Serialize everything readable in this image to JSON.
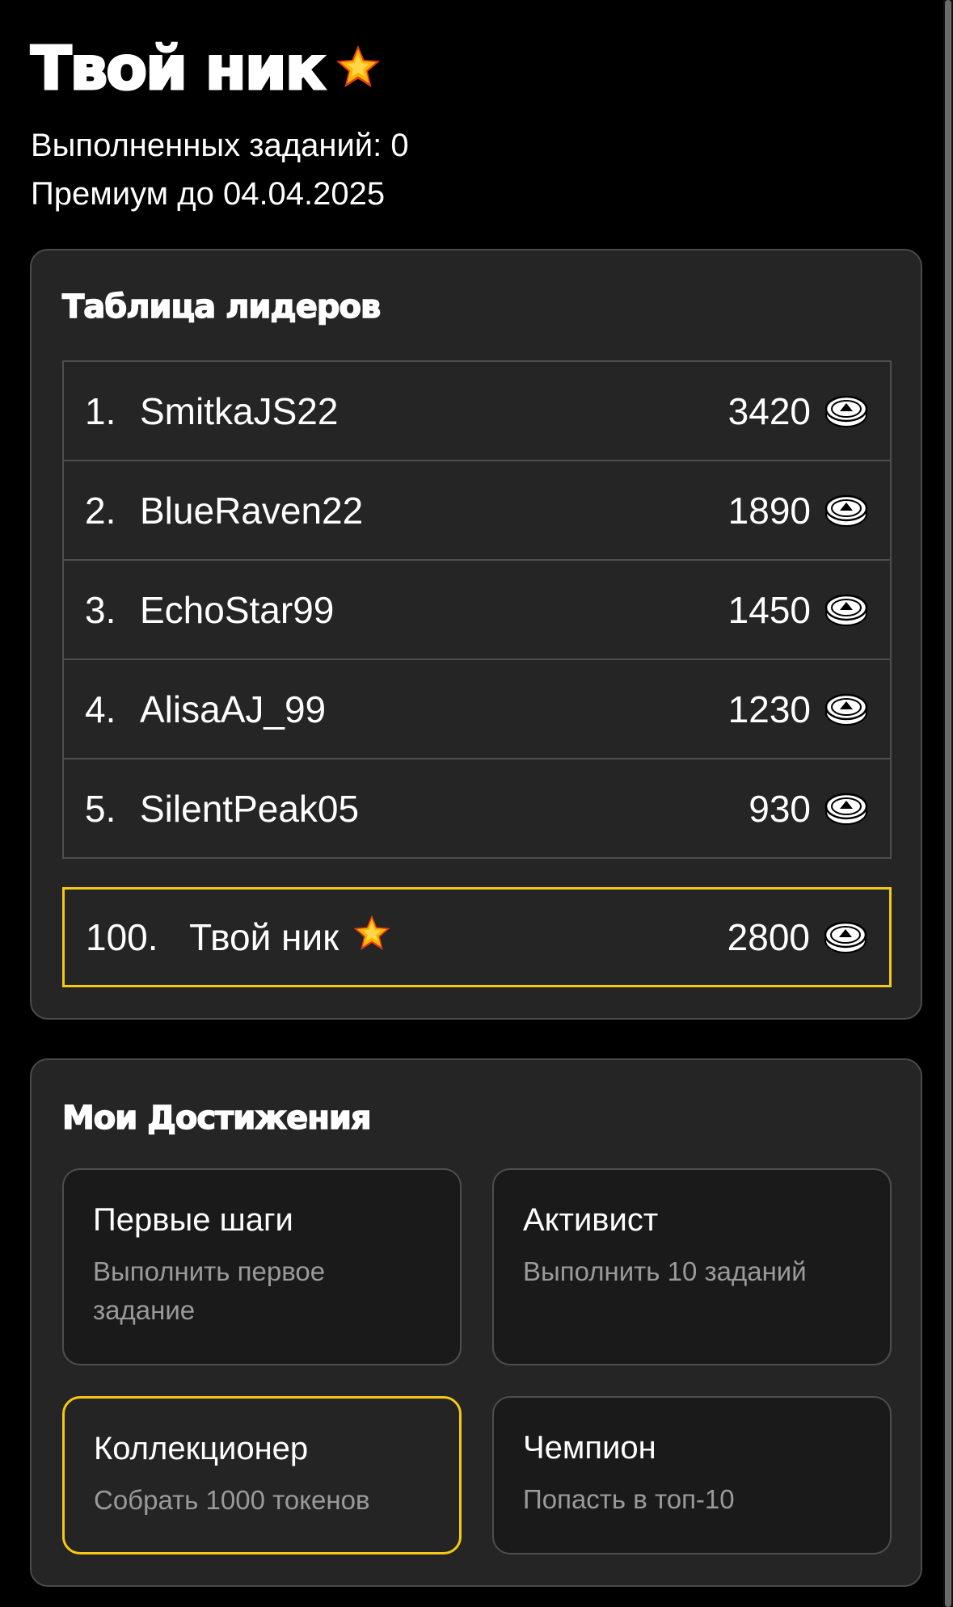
{
  "header": {
    "title": "Твой ник",
    "star_icon": "star-icon",
    "completed_tasks": "Выполненных заданий: 0",
    "premium_until": "Премиум до 04.04.2025"
  },
  "leaderboard": {
    "title": "Таблица лидеров",
    "coin_icon": "coin-icon",
    "rows": [
      {
        "rank": "1.",
        "nick": "SmitkaJS22",
        "score": "3420"
      },
      {
        "rank": "2.",
        "nick": "BlueRaven22",
        "score": "1890"
      },
      {
        "rank": "3.",
        "nick": "EchoStar99",
        "score": "1450"
      },
      {
        "rank": "4.",
        "nick": "AlisaAJ_99",
        "score": "1230"
      },
      {
        "rank": "5.",
        "nick": "SilentPeak05",
        "score": "930"
      }
    ],
    "me": {
      "rank": "100.",
      "nick": "Твой ник",
      "score": "2800"
    }
  },
  "achievements": {
    "title": "Мои Достижения",
    "items": [
      {
        "title": "Первые шаги",
        "description": "Выполнить первое задание",
        "highlighted": false
      },
      {
        "title": "Активист",
        "description": "Выполнить 10 заданий",
        "highlighted": false
      },
      {
        "title": "Коллекционер",
        "description": "Собрать 1000 токенов",
        "highlighted": true
      },
      {
        "title": "Чемпион",
        "description": "Попасть в топ-10",
        "highlighted": false
      }
    ]
  },
  "colors": {
    "background": "#000000",
    "card": "#252525",
    "accent": "#f5c814",
    "muted_text": "#9a9a9a"
  }
}
